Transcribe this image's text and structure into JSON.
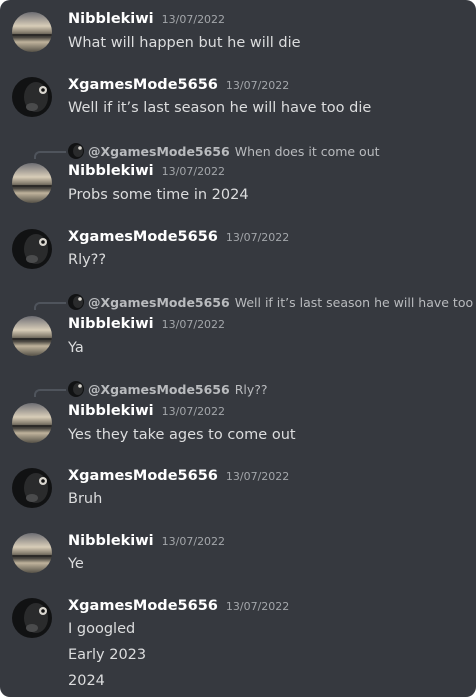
{
  "messages": [
    {
      "author": "Nibblekiwi",
      "timestamp": "13/07/2022",
      "avatar": "sunset-avatar",
      "lines": [
        "What will happen but he will die"
      ]
    },
    {
      "author": "XgamesMode5656",
      "timestamp": "13/07/2022",
      "avatar": "dark-creature-avatar",
      "lines": [
        "Well if it’s last season he will have too die"
      ]
    },
    {
      "author": "Nibblekiwi",
      "timestamp": "13/07/2022",
      "avatar": "sunset-avatar",
      "reply": {
        "mention": "@XgamesMode5656",
        "text": "When does it come out"
      },
      "lines": [
        "Probs some time in 2024"
      ]
    },
    {
      "author": "XgamesMode5656",
      "timestamp": "13/07/2022",
      "avatar": "dark-creature-avatar",
      "lines": [
        "Rly??"
      ]
    },
    {
      "author": "Nibblekiwi",
      "timestamp": "13/07/2022",
      "avatar": "sunset-avatar",
      "reply": {
        "mention": "@XgamesMode5656",
        "text": "Well if it’s last season he will have too die"
      },
      "lines": [
        "Ya"
      ]
    },
    {
      "author": "Nibblekiwi",
      "timestamp": "13/07/2022",
      "avatar": "sunset-avatar",
      "reply": {
        "mention": "@XgamesMode5656",
        "text": "Rly??"
      },
      "lines": [
        "Yes they take ages to come out"
      ]
    },
    {
      "author": "XgamesMode5656",
      "timestamp": "13/07/2022",
      "avatar": "dark-creature-avatar",
      "lines": [
        "Bruh"
      ]
    },
    {
      "author": "Nibblekiwi",
      "timestamp": "13/07/2022",
      "avatar": "sunset-avatar",
      "lines": [
        "Ye"
      ]
    },
    {
      "author": "XgamesMode5656",
      "timestamp": "13/07/2022",
      "avatar": "dark-creature-avatar",
      "lines": [
        "I googled",
        "Early 2023",
        "2024"
      ]
    }
  ]
}
